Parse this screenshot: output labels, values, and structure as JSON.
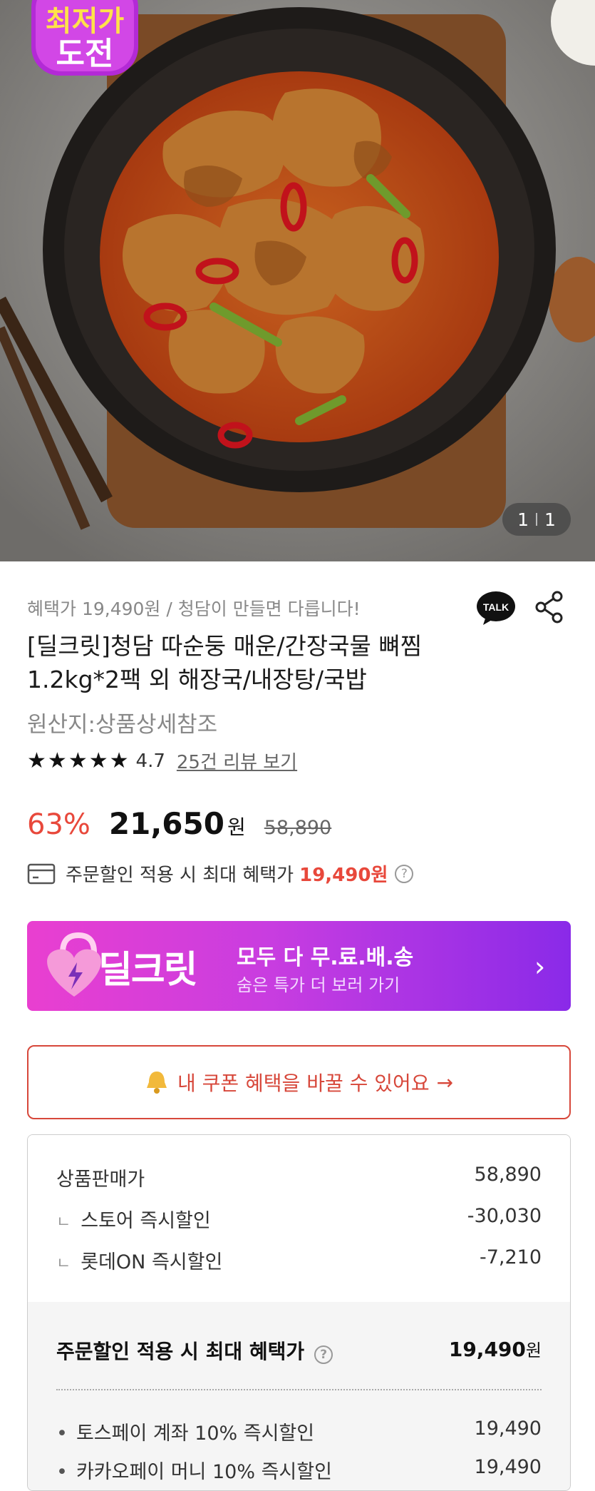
{
  "hero": {
    "badge_line1": "최저가",
    "badge_line2": "도전",
    "image_counter_current": "1",
    "image_counter_total": "1"
  },
  "product": {
    "promo_line": "혜택가 19,490원 / 청담이 만들면 다릅니다!",
    "talk_label": "TALK",
    "title_line1": "[딜크릿]청담 따순둥 매운/간장국물 뼈찜",
    "title_line2": "1.2kg*2팩 외 해장국/내장탕/국밥",
    "origin": "원산지:상품상세참조",
    "rating": 4.7,
    "rating_text": "4.7",
    "review_link": "25건 리뷰 보기",
    "discount_pct": "63%",
    "price": "21,650",
    "price_unit": "원",
    "original_price": "58,890",
    "max_benefit_label": "주문할인 적용 시 최대 혜택가",
    "max_benefit_value": "19,490원",
    "help_glyph": "?"
  },
  "banner": {
    "brand": "딜크릿",
    "main": "모두 다 무.료.배.송",
    "sub": "숨은 특가 더 보러 가기",
    "arrow": "›"
  },
  "coupon": {
    "label": "내 쿠폰 혜택을 바꿀 수 있어요",
    "arrow": "→"
  },
  "breakdown": {
    "rows": [
      {
        "label": "상품판매가",
        "value": "58,890"
      },
      {
        "label": "스토어 즉시할인",
        "value": "-30,030"
      },
      {
        "label": "롯데ON 즉시할인",
        "value": "-7,210"
      }
    ],
    "sub_marker": "ㄴ",
    "total_label": "주문할인 적용 시 최대 혜택가",
    "total_value": "19,490",
    "total_unit": "원",
    "payments": [
      {
        "label": "토스페이 계좌 10% 즉시할인",
        "value": "19,490"
      },
      {
        "label": "카카오페이 머니 10% 즉시할인",
        "value": "19,490"
      }
    ],
    "bullet": "•"
  },
  "colors": {
    "accent_red": "#e8483b",
    "banner_start": "#e93fd0",
    "banner_end": "#8a2ae8",
    "coupon_red": "#d7473a"
  }
}
